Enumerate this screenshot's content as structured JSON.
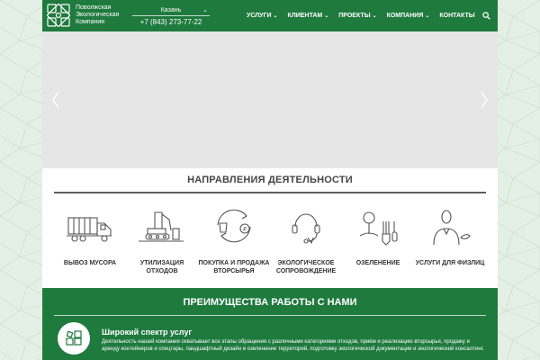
{
  "header": {
    "brand_lines": [
      "Поволжская",
      "Экологическая",
      "Компания"
    ],
    "city": "Казань",
    "phone": "+7 (843) 273-77-22"
  },
  "nav": {
    "items": [
      {
        "label": "УСЛУГИ",
        "has_dropdown": true
      },
      {
        "label": "КЛИЕНТАМ",
        "has_dropdown": true
      },
      {
        "label": "ПРОЕКТЫ",
        "has_dropdown": true
      },
      {
        "label": "КОМПАНИЯ",
        "has_dropdown": true
      },
      {
        "label": "КОНТАКТЫ",
        "has_dropdown": false
      }
    ],
    "search_icon": "search-icon"
  },
  "directions": {
    "title": "НАПРАВЛЕНИЯ ДЕЯТЕЛЬНОСТИ",
    "items": [
      {
        "label": "ВЫВОЗ МУСОРА",
        "icon": "garbage-truck-icon"
      },
      {
        "label": "УТИЛИЗАЦИЯ\nОТХОДОВ",
        "icon": "excavator-icon"
      },
      {
        "label": "ПОКУПКА И ПРОДАЖА\nВТОРСЫРЬЯ",
        "icon": "recycle-exchange-icon"
      },
      {
        "label": "ЭКОЛОГИЧЕСКОЕ\nСОПРОВОЖДЕНИЕ",
        "icon": "headset-icon"
      },
      {
        "label": "ОЗЕЛЕНЕНИЕ",
        "icon": "gardening-icon"
      },
      {
        "label": "УСЛУГИ ДЛЯ ФИЗЛИЦ",
        "icon": "person-icon"
      }
    ]
  },
  "advantages": {
    "title": "ПРЕИМУЩЕСТВА РАБОТЫ С НАМИ",
    "heading": "Широкий спектр услуг",
    "text": "Деятельность нашей компании охватывает все этапы обращения с различными категориями отходов, приём и реализацию вторсырья, продажу и аренду контейнеров и спецтары, ландшафтный дизайн и озеленение территорий, подготовку экологической документации и экологический консалтинг."
  },
  "colors": {
    "brand_green": "#1f7a3e",
    "page_background": "#e4efe6",
    "slider_gray": "#e6e6e6"
  }
}
